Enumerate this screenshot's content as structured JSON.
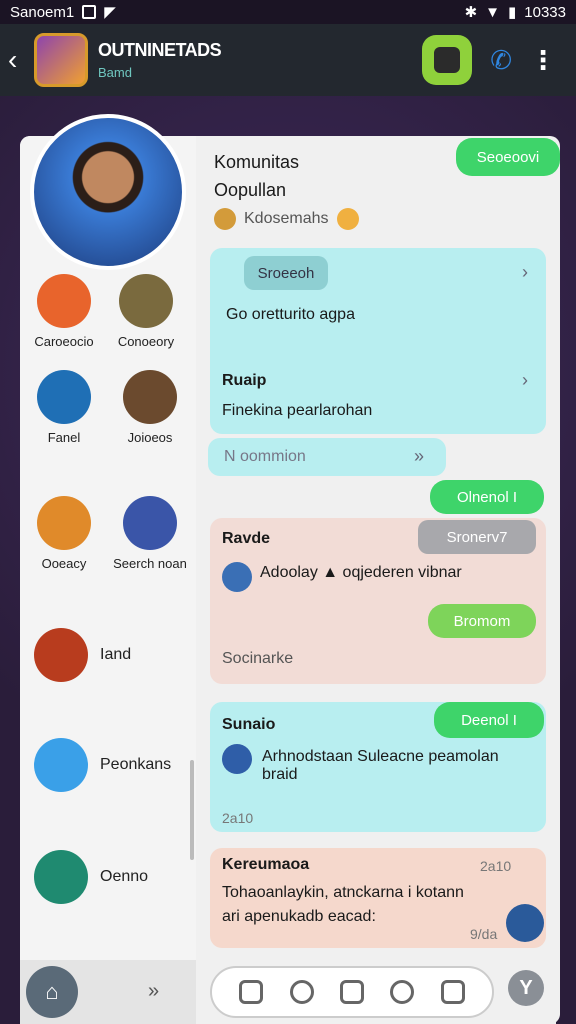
{
  "status_bar": {
    "carrier": "Sanoem1",
    "time": "10333"
  },
  "app_bar": {
    "title": "OUTNINETADS",
    "subtitle": "Bamd"
  },
  "sidebar": {
    "contacts": [
      {
        "name": "Caroeocio",
        "color": "#e8642c"
      },
      {
        "name": "Conoeory",
        "color": "#7a6a3e"
      },
      {
        "name": "Fanel",
        "color": "#1f6fb5"
      },
      {
        "name": "Joioeos",
        "color": "#6b4a2e"
      },
      {
        "name": "Ooeacy",
        "color": "#e08a2a"
      },
      {
        "name": "Seerch noan",
        "color": "#3a55a8"
      },
      {
        "name": "Iand",
        "color": "#b83c1e"
      },
      {
        "name": "Peonkans",
        "color": "#3aa0e8"
      },
      {
        "name": "Oenno",
        "color": "#1f8a70"
      }
    ]
  },
  "chat_header": {
    "title_line1": "Komunitas",
    "title_line2": "Oopullan",
    "subtitle": "Kdosemahs",
    "action_label": "Seoeoovi"
  },
  "messages": {
    "card1": {
      "pill": "Sroeeoh",
      "text1": "Go oretturito agpa",
      "heading": "Ruaip",
      "text2": "Finekina pearlarohan"
    },
    "notice": {
      "text": "N oommion",
      "badge": "Olnenol I"
    },
    "card2": {
      "heading": "Ravde",
      "pill": "Sronerv7",
      "text": "Adoolay ▲ oqjederen vibnar",
      "pill2": "Bromom",
      "footer": "Socinarke"
    },
    "card3": {
      "badge": "Deenol I",
      "heading": "Sunaio",
      "text": "Arhnodstaan Suleacne peamolan braid",
      "time": "2a10"
    },
    "card4": {
      "heading": "Kereumaoa",
      "time": "2a10",
      "text1": "Tohaoanlaykin, atnckarna i kotann",
      "text2": "ari apenukadb eacad:",
      "time2": "9/da"
    }
  },
  "colors": {
    "accent_green": "#3ed46a",
    "teal_bubble": "#b8eef0",
    "pink_bubble": "#f2dcd6"
  }
}
